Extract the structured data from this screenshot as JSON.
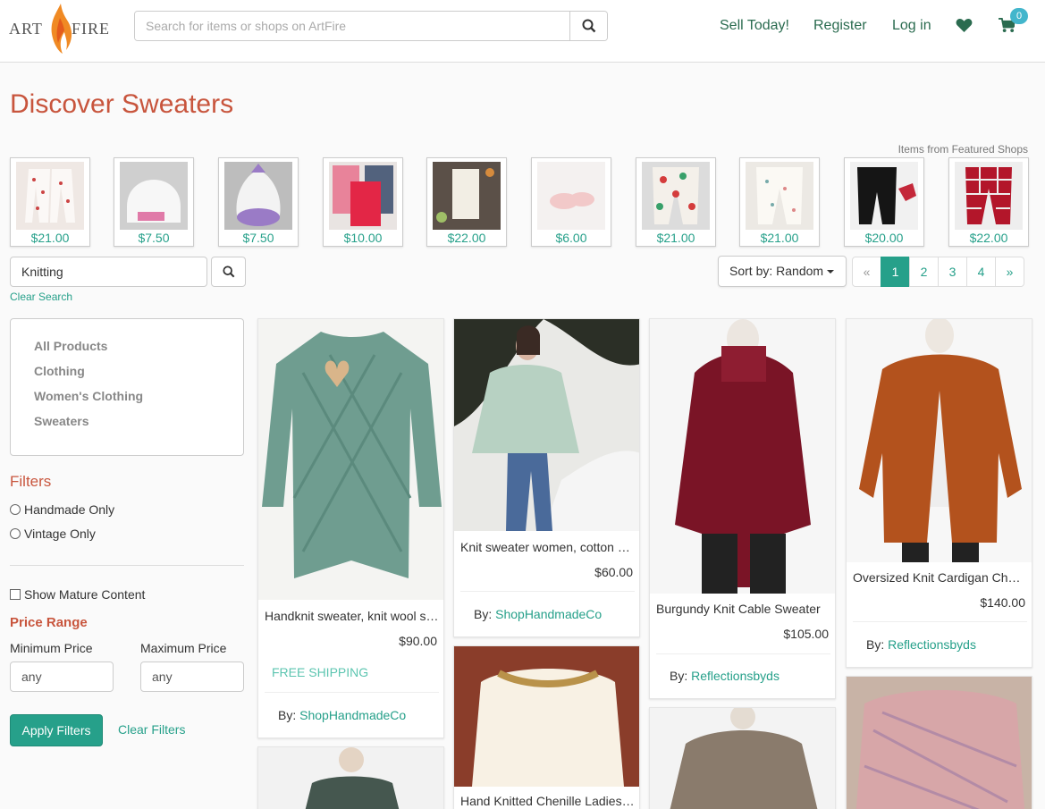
{
  "header": {
    "logo_left": "ART",
    "logo_right": "FIRE",
    "search_placeholder": "Search for items or shops on ArtFire",
    "nav": [
      "Sell Today!",
      "Register",
      "Log in"
    ],
    "cart_count": "0"
  },
  "page_title": "Discover Sweaters",
  "featured_label": "Items from Featured Shops",
  "featured": [
    {
      "price": "$21.00"
    },
    {
      "price": "$7.50"
    },
    {
      "price": "$7.50"
    },
    {
      "price": "$10.00"
    },
    {
      "price": "$22.00"
    },
    {
      "price": "$6.00"
    },
    {
      "price": "$21.00"
    },
    {
      "price": "$21.00"
    },
    {
      "price": "$20.00"
    },
    {
      "price": "$22.00"
    }
  ],
  "keyword_value": "Knitting",
  "clear_search": "Clear Search",
  "sort_label": "Sort by: Random",
  "pagination": [
    "«",
    "1",
    "2",
    "3",
    "4",
    "»"
  ],
  "categories": [
    "All Products",
    "Clothing",
    "Women's Clothing",
    "Sweaters"
  ],
  "filters": {
    "title": "Filters",
    "handmade": "Handmade Only",
    "vintage": "Vintage Only",
    "mature": "Show Mature Content",
    "price_range": "Price Range",
    "min_label": "Minimum Price",
    "max_label": "Maximum Price",
    "min_value": "any",
    "max_value": "any",
    "apply": "Apply Filters",
    "clear": "Clear Filters"
  },
  "products": [
    {
      "title": "Handknit sweater, knit wool sweater",
      "price": "$90.00",
      "shipping": "FREE SHIPPING",
      "by": "By:",
      "shop": "ShopHandmadeCo"
    },
    {
      "title": "Knit sweater women, cotton sweater",
      "price": "$60.00",
      "by": "By:",
      "shop": "ShopHandmadeCo"
    },
    {
      "title": "Burgundy Knit Cable Sweater",
      "price": "$105.00",
      "by": "By:",
      "shop": "Reflectionsbyds"
    },
    {
      "title": "Oversized Knit Cardigan Chunky",
      "price": "$140.00",
      "by": "By:",
      "shop": "Reflectionsbyds"
    },
    {
      "title": "Hand Knitted Chenille Ladies Sweater"
    }
  ]
}
